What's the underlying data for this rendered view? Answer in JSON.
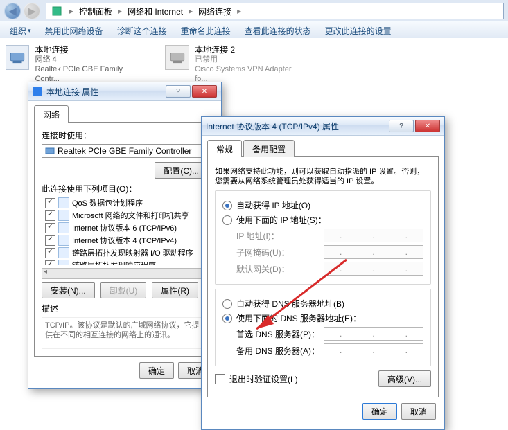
{
  "breadcrumbs": {
    "root": "控制面板",
    "mid": "网络和 Internet",
    "leaf": "网络连接"
  },
  "cmdbar": {
    "org": "组织",
    "org_arr": "▾",
    "disable": "禁用此网络设备",
    "diag": "诊断这个连接",
    "rename": "重命名此连接",
    "status": "查看此连接的状态",
    "change": "更改此连接的设置"
  },
  "connections": {
    "a": {
      "title": "本地连接",
      "sub1": "网络 4",
      "sub2": "Realtek PCIe GBE Family Contr..."
    },
    "b": {
      "title": "本地连接 2",
      "sub1": "已禁用",
      "sub2": "Cisco Systems VPN Adapter fo..."
    }
  },
  "dlg1": {
    "title": "本地连接 属性",
    "tab": "网络",
    "connect_using": "连接时使用：",
    "nic": "Realtek PCIe GBE Family Controller",
    "configure": "配置(C)...",
    "items_label": "此连接使用下列项目(O)：",
    "items": [
      "QoS 数据包计划程序",
      "Microsoft 网络的文件和打印机共享",
      "Internet 协议版本 6 (TCP/IPv6)",
      "Internet 协议版本 4 (TCP/IPv4)",
      "链路层拓扑发现映射器 I/O 驱动程序",
      "链路层拓扑发现响应程序"
    ],
    "install": "安装(N)...",
    "uninstall": "卸载(U)",
    "properties": "属性(R)",
    "desc_label": "描述",
    "desc": "TCP/IP。该协议是默认的广域网络协议，它提供在不同的相互连接的网络上的通讯。",
    "ok": "确定",
    "cancel": "取消"
  },
  "dlg2": {
    "title": "Internet 协议版本 4 (TCP/IPv4) 属性",
    "tabs": {
      "general": "常规",
      "alt": "备用配置"
    },
    "intro": "如果网络支持此功能，则可以获取自动指派的 IP 设置。否则，您需要从网络系统管理员处获得适当的 IP 设置。",
    "auto_ip": "自动获得 IP 地址(O)",
    "use_ip": "使用下面的 IP 地址(S)：",
    "ip": "IP 地址(I)：",
    "mask": "子网掩码(U)：",
    "gw": "默认网关(D)：",
    "auto_dns": "自动获得 DNS 服务器地址(B)",
    "use_dns": "使用下面的 DNS 服务器地址(E)：",
    "dns1": "首选 DNS 服务器(P)：",
    "dns2": "备用 DNS 服务器(A)：",
    "validate": "退出时验证设置(L)",
    "advanced": "高级(V)...",
    "ok": "确定",
    "cancel": "取消"
  }
}
